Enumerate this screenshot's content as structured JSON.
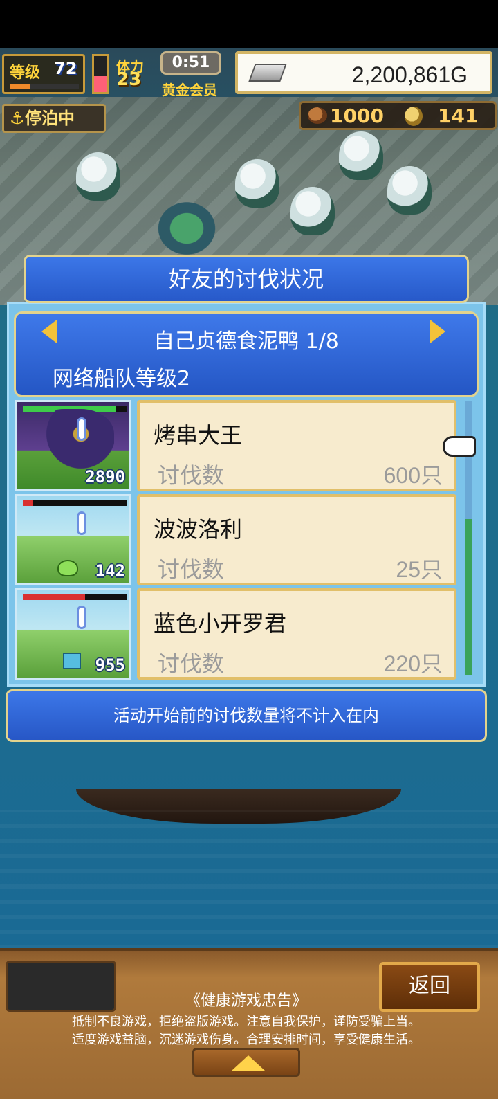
{
  "hud": {
    "level_label": "等级",
    "level_value": "72",
    "level_progress": 0.3,
    "hp_fill": 0.45,
    "stamina_label": "体力",
    "stamina_value": "23",
    "timer": "0:51",
    "membership": "黄金会员",
    "gold": "2,200,861G",
    "status": "停泊中",
    "resource_1": "1000",
    "resource_2": "141"
  },
  "dialog": {
    "title": "好友的讨伐状况",
    "friend_name": "自己贞德食泥鸭 1/8",
    "fleet_level": "网络船队等级2",
    "rows": [
      {
        "name": "烤串大王",
        "label": "讨伐数",
        "value": "600只",
        "monster_count": "2890",
        "hp_fill": 0.9,
        "hp_color": "#3ecb4a"
      },
      {
        "name": "波波洛利",
        "label": "讨伐数",
        "value": "25只",
        "monster_count": "142",
        "hp_fill": 0.1,
        "hp_color": "#d93131"
      },
      {
        "name": "蓝色小开罗君",
        "label": "讨伐数",
        "value": "220只",
        "monster_count": "955",
        "hp_fill": 0.6,
        "hp_color": "#d93131"
      }
    ],
    "notice": "活动开始前的讨伐数量将不计入在内"
  },
  "bottom": {
    "back_label": "返回",
    "advisory_title": "《健康游戏忠告》",
    "advisory_line_1": "抵制不良游戏，拒绝盗版游戏。注意自我保护，谨防受骗上当。",
    "advisory_line_2": "适度游戏益脑，沉迷游戏伤身。合理安排时间，享受健康生活。"
  }
}
